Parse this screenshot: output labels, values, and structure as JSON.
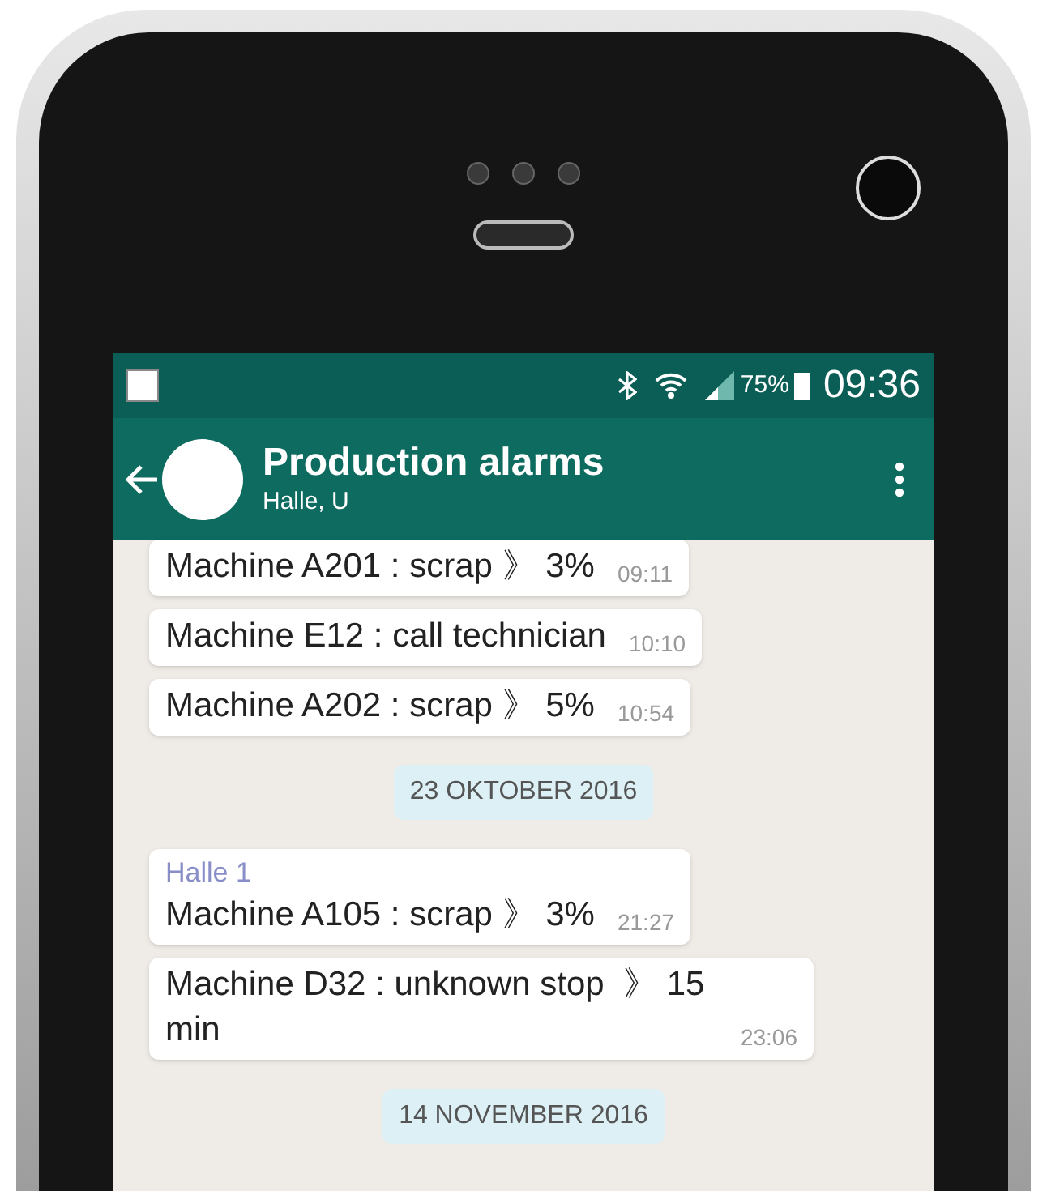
{
  "status_bar": {
    "battery": "75%",
    "time": "09:36"
  },
  "header": {
    "title": "Production alarms",
    "subtitle": "Halle, U"
  },
  "messages": [
    {
      "kind": "message",
      "text": "Machine A201 : scrap 》 3%",
      "time": "09:11"
    },
    {
      "kind": "message",
      "text": "Machine E12 : call technician",
      "time": "10:10"
    },
    {
      "kind": "message",
      "text": "Machine A202 : scrap 》 5%",
      "time": "10:54"
    },
    {
      "kind": "date",
      "text": "23 OKTOBER 2016"
    },
    {
      "kind": "message",
      "sender": "Halle 1",
      "text": "Machine A105 : scrap 》 3%",
      "time": "21:27"
    },
    {
      "kind": "message",
      "text": "Machine D32 : unknown stop  》 15 min",
      "time": "23:06"
    },
    {
      "kind": "date",
      "text": "14 NOVEMBER 2016"
    }
  ]
}
